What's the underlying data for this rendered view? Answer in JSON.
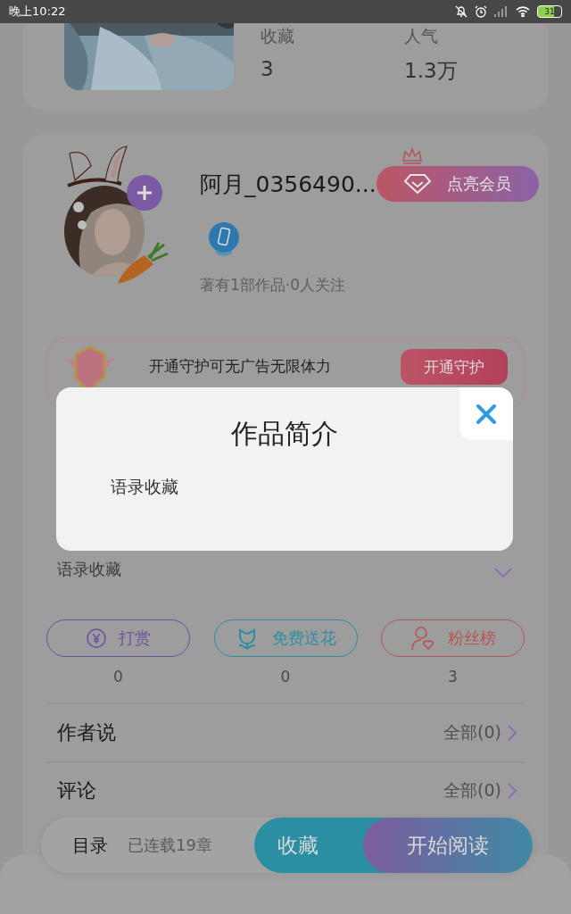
{
  "status_bar": {
    "time": "晚上10:22",
    "battery": "31"
  },
  "book": {
    "stats": [
      {
        "label": "收藏",
        "value": "3"
      },
      {
        "label": "人气",
        "value": "1.3万"
      }
    ]
  },
  "author": {
    "name": "阿月_0356490...",
    "vip_button": "点亮会员",
    "summary": "著有1部作品·0人关注"
  },
  "guard_banner": {
    "text": "开通守护可无广告无限体力",
    "button": "开通守护"
  },
  "intro_preview": "语录收藏",
  "actions": [
    {
      "kind": "reward",
      "label": "打赏",
      "count": "0",
      "color": "#6f4fa0"
    },
    {
      "kind": "flower",
      "label": "免费送花",
      "count": "0",
      "color": "#2c8ea2"
    },
    {
      "kind": "fans",
      "label": "粉丝榜",
      "count": "3",
      "color": "#b55454"
    }
  ],
  "sections": [
    {
      "title": "作者说",
      "link": "全部(0)"
    },
    {
      "title": "评论",
      "link": "全部(0)"
    }
  ],
  "bottom_bar": {
    "toc": "目录",
    "chapters": "已连载19章",
    "collect": "收藏",
    "read": "开始阅读"
  },
  "modal": {
    "title": "作品简介",
    "body": "语录收藏"
  }
}
